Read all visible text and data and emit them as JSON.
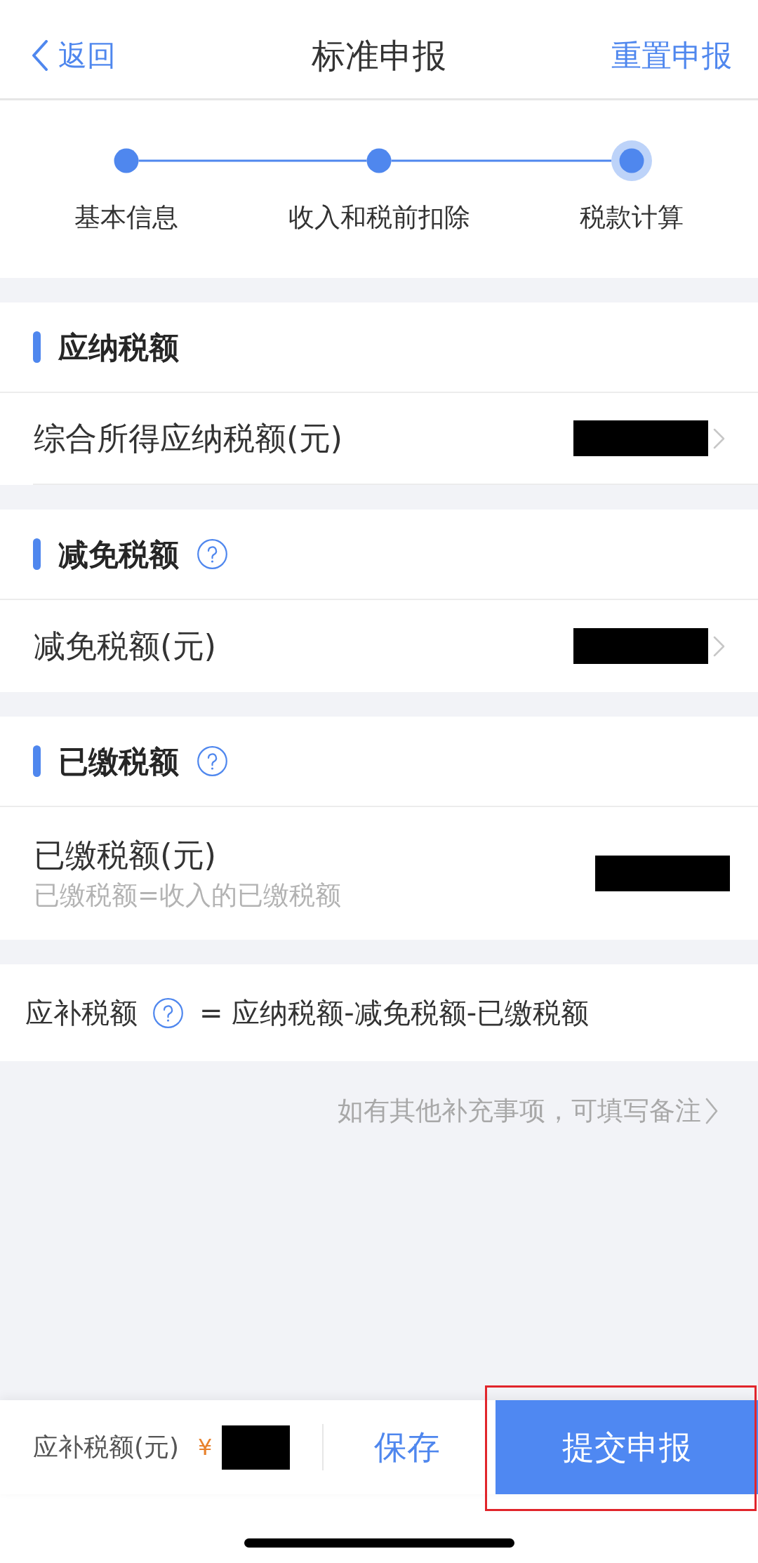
{
  "nav": {
    "back": "返回",
    "title": "标准申报",
    "action": "重置申报"
  },
  "steps": [
    {
      "label": "基本信息",
      "selected": false
    },
    {
      "label": "收入和税前扣除",
      "selected": false
    },
    {
      "label": "税款计算",
      "selected": true
    }
  ],
  "sections": [
    {
      "title": "应纳税额",
      "help": false,
      "rows": [
        {
          "label": "综合所得应纳税额(元)",
          "redacted": true,
          "chevron": true,
          "divider": true
        }
      ]
    },
    {
      "title": "减免税额",
      "help": true,
      "rows": [
        {
          "label": "减免税额(元)",
          "redacted": true,
          "chevron": true,
          "divider": false
        }
      ]
    },
    {
      "title": "已缴税额",
      "help": true,
      "rows": [
        {
          "label": "已缴税额(元)",
          "note": "已缴税额=收入的已缴税额",
          "redacted": true,
          "chevron": false,
          "divider": false
        }
      ]
    }
  ],
  "formula": {
    "term": "应补税额",
    "help": true,
    "expression": "= 应纳税额-减免税额-已缴税额"
  },
  "remark_link": "如有其他补充事项，可填写备注",
  "bottom_bar": {
    "label": "应补税额(元)",
    "currency": "¥",
    "redacted": true,
    "save": "保存",
    "submit": "提交申报",
    "submit_highlighted": true
  }
}
